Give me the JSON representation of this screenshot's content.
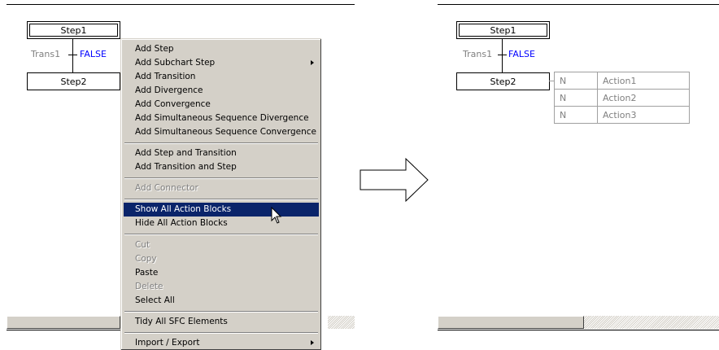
{
  "left_panel": {
    "step1": "Step1",
    "trans_name": "Trans1",
    "trans_condition": "FALSE",
    "step2": "Step2"
  },
  "context_menu": {
    "items": [
      {
        "label": "Add Step",
        "disabled": false,
        "submenu": false
      },
      {
        "label": "Add Subchart Step",
        "disabled": false,
        "submenu": true
      },
      {
        "label": "Add Transition",
        "disabled": false,
        "submenu": false
      },
      {
        "label": "Add Divergence",
        "disabled": false,
        "submenu": false
      },
      {
        "label": "Add Convergence",
        "disabled": false,
        "submenu": false
      },
      {
        "label": "Add Simultaneous Sequence Divergence",
        "disabled": false,
        "submenu": false
      },
      {
        "label": "Add Simultaneous Sequence Convergence",
        "disabled": false,
        "submenu": false
      },
      {
        "label": "Add Step and Transition",
        "disabled": false,
        "submenu": false
      },
      {
        "label": "Add Transition and Step",
        "disabled": false,
        "submenu": false
      },
      {
        "label": "Add Connector",
        "disabled": true,
        "submenu": false
      },
      {
        "label": "Show All Action Blocks",
        "disabled": false,
        "submenu": false,
        "highlighted": true
      },
      {
        "label": "Hide All Action Blocks",
        "disabled": false,
        "submenu": false
      },
      {
        "label": "Cut",
        "disabled": true,
        "submenu": false
      },
      {
        "label": "Copy",
        "disabled": true,
        "submenu": false
      },
      {
        "label": "Paste",
        "disabled": false,
        "submenu": false
      },
      {
        "label": "Delete",
        "disabled": true,
        "submenu": false
      },
      {
        "label": "Select All",
        "disabled": false,
        "submenu": false
      },
      {
        "label": "Tidy All SFC Elements",
        "disabled": false,
        "submenu": false
      },
      {
        "label": "Import / Export",
        "disabled": false,
        "submenu": true
      }
    ]
  },
  "right_panel": {
    "step1": "Step1",
    "trans_name": "Trans1",
    "trans_condition": "FALSE",
    "step2": "Step2",
    "actions": [
      {
        "qualifier": "N",
        "name": "Action1"
      },
      {
        "qualifier": "N",
        "name": "Action2"
      },
      {
        "qualifier": "N",
        "name": "Action3"
      }
    ]
  },
  "icons": {
    "arrow": "right-arrow-icon",
    "cursor": "mouse-pointer-icon"
  }
}
